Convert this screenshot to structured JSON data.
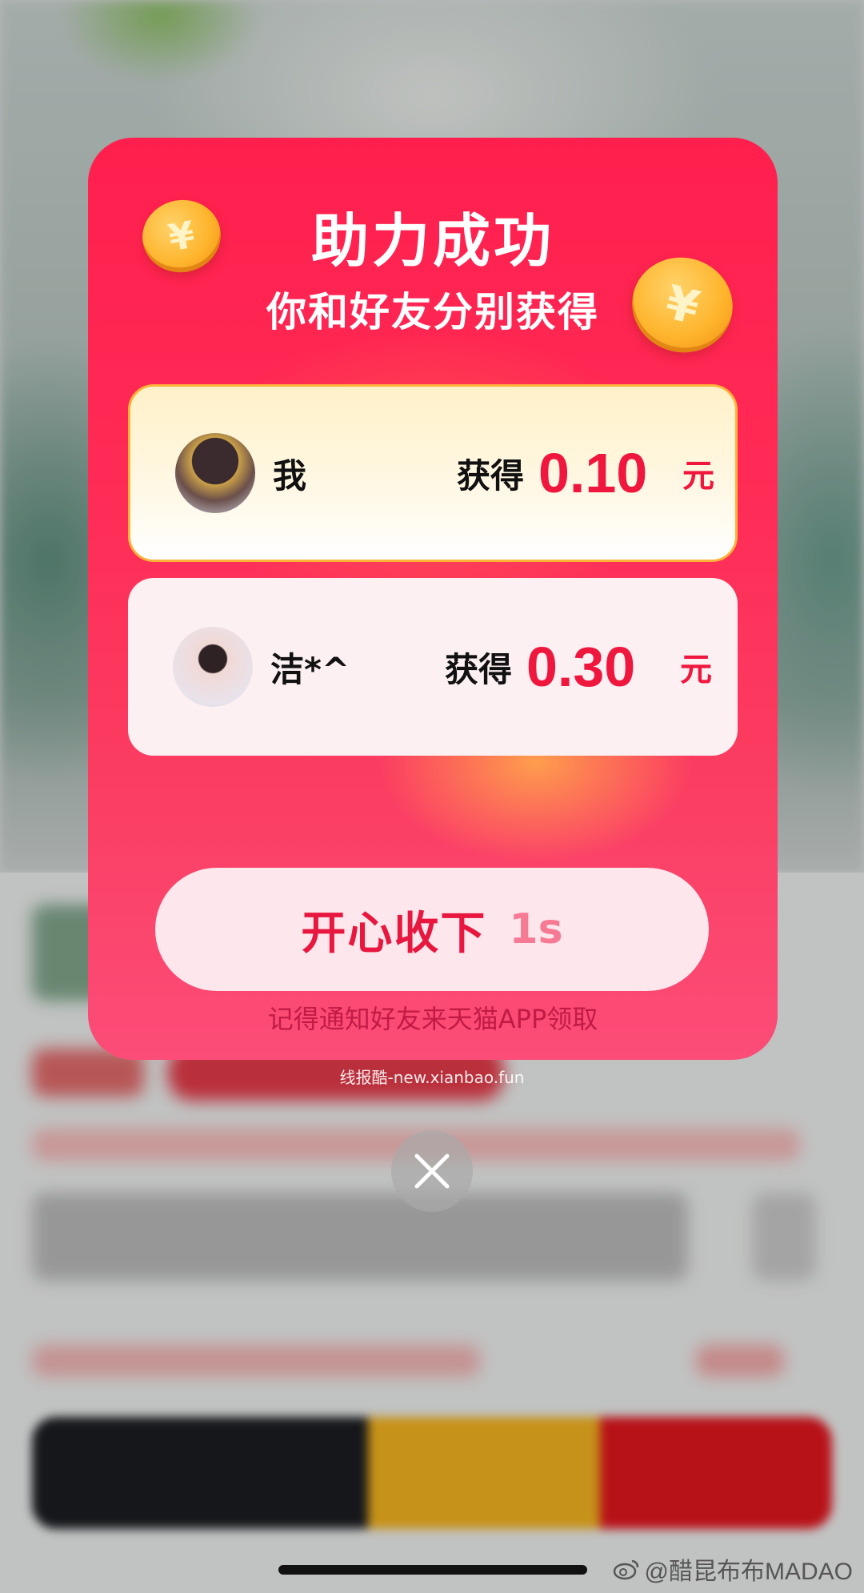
{
  "popup": {
    "title": "助力成功",
    "subtitle": "你和好友分别获得",
    "rewards": [
      {
        "name": "我",
        "gain_label": "获得",
        "amount": "0.10",
        "unit": "元"
      },
      {
        "name": "洁*^",
        "gain_label": "获得",
        "amount": "0.30",
        "unit": "元"
      }
    ],
    "accept_button": {
      "label": "开心收下",
      "countdown": "1s"
    },
    "note": "记得通知好友来天猫APP领取",
    "coin_symbol": "¥"
  },
  "watermark": "线报酷-new.xianbao.fun",
  "social_credit": "@醋昆布布MADAO",
  "colors": {
    "popup_red": "#ff1f4e",
    "amount_red": "#f0173f",
    "button_bg": "#fde6ec",
    "highlight_border": "#ffb238"
  }
}
